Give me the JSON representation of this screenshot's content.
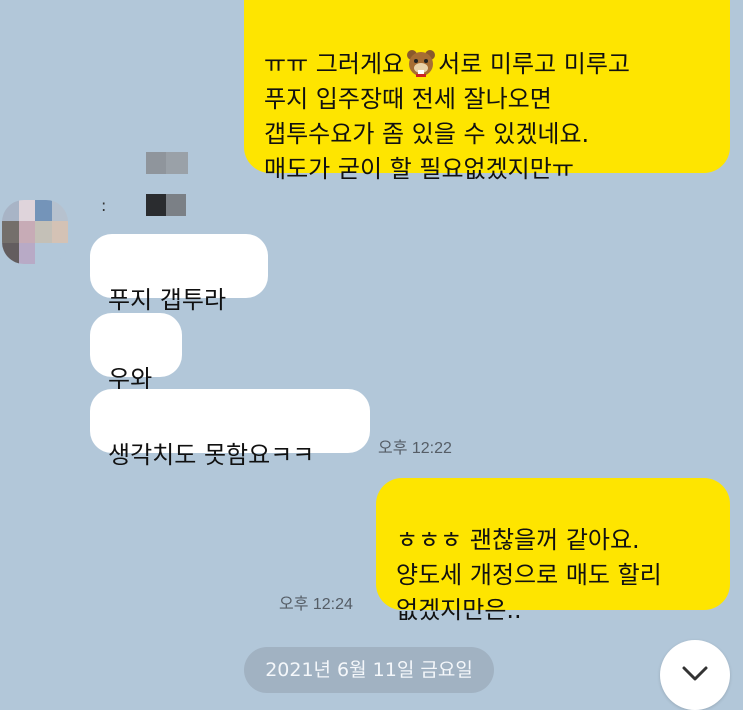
{
  "messages": [
    {
      "sender": "me",
      "line1": "ㅠㅠ 그러게요",
      "line1b": "서로 미루고 미루고",
      "rest": "푸지 입주장때 전세 잘나오면\n갭투수요가 좀 있을 수 있겠네요.\n매도가 굳이 할 필요없겠지만ㅠ",
      "emoji": "bear-emoticon"
    },
    {
      "sender": "other",
      "text": "푸지 갭투라"
    },
    {
      "sender": "other",
      "text": "우와"
    },
    {
      "sender": "other",
      "text": "생각치도 못함요ㅋㅋ",
      "time": "오후 12:22"
    },
    {
      "sender": "me",
      "text": "ㅎㅎㅎ 괜찮을꺼 같아요.\n양도세 개정으로 매도 할리\n없겠지만은..",
      "time": "오후 12:24"
    }
  ],
  "sender_name_suffix": ":",
  "date_divider": "2021년 6월 11일 금요일",
  "icons": {
    "scroll": "chevron-down-icon",
    "avatar": "profile-avatar"
  },
  "colors": {
    "background": "#b2c7d9",
    "my_bubble": "#fee500",
    "their_bubble": "#ffffff"
  }
}
